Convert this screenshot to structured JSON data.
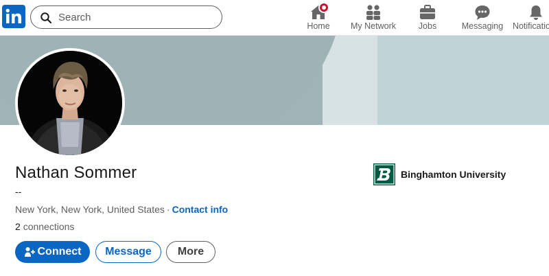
{
  "nav": {
    "search_placeholder": "Search",
    "items": [
      {
        "label": "Home",
        "icon": "home-icon"
      },
      {
        "label": "My Network",
        "icon": "network-icon"
      },
      {
        "label": "Jobs",
        "icon": "briefcase-icon"
      },
      {
        "label": "Messaging",
        "icon": "messaging-icon"
      },
      {
        "label": "Notifications",
        "icon": "bell-icon"
      }
    ]
  },
  "profile": {
    "name": "Nathan Sommer",
    "headline": "--",
    "location": "New York, New York, United States",
    "separator": "·",
    "contact_link": "Contact info",
    "connections_count": "2",
    "connections_label": "connections"
  },
  "actions": {
    "connect": "Connect",
    "message": "Message",
    "more": "More"
  },
  "education": {
    "school": "Binghamton University"
  },
  "colors": {
    "brand": "#0a66c2",
    "notification_badge": "#cb112d",
    "school_green": "#005a43"
  }
}
